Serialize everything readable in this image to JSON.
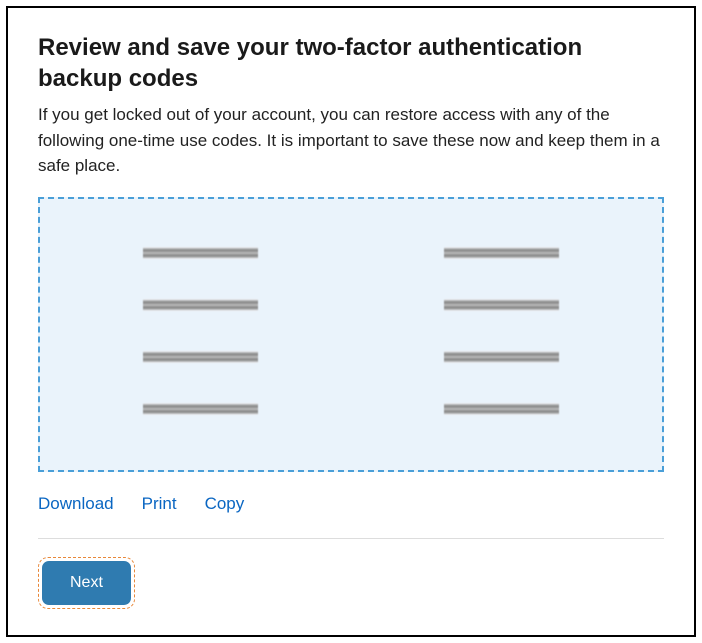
{
  "title": "Review and save your two-factor authentication backup codes",
  "description": "If you get locked out of your account, you can restore access with any of the following one-time use codes. It is important to save these now and keep them in a safe place.",
  "backup_codes": {
    "left_column": [
      "",
      "",
      "",
      ""
    ],
    "right_column": [
      "",
      "",
      "",
      ""
    ],
    "redacted": true
  },
  "actions": {
    "download": "Download",
    "print": "Print",
    "copy": "Copy"
  },
  "next_label": "Next",
  "colors": {
    "link": "#0a66c2",
    "codes_bg": "#eaf3fb",
    "codes_border": "#4a9fd8",
    "next_bg": "#2f7bb0",
    "highlight_border": "#e8883a"
  }
}
